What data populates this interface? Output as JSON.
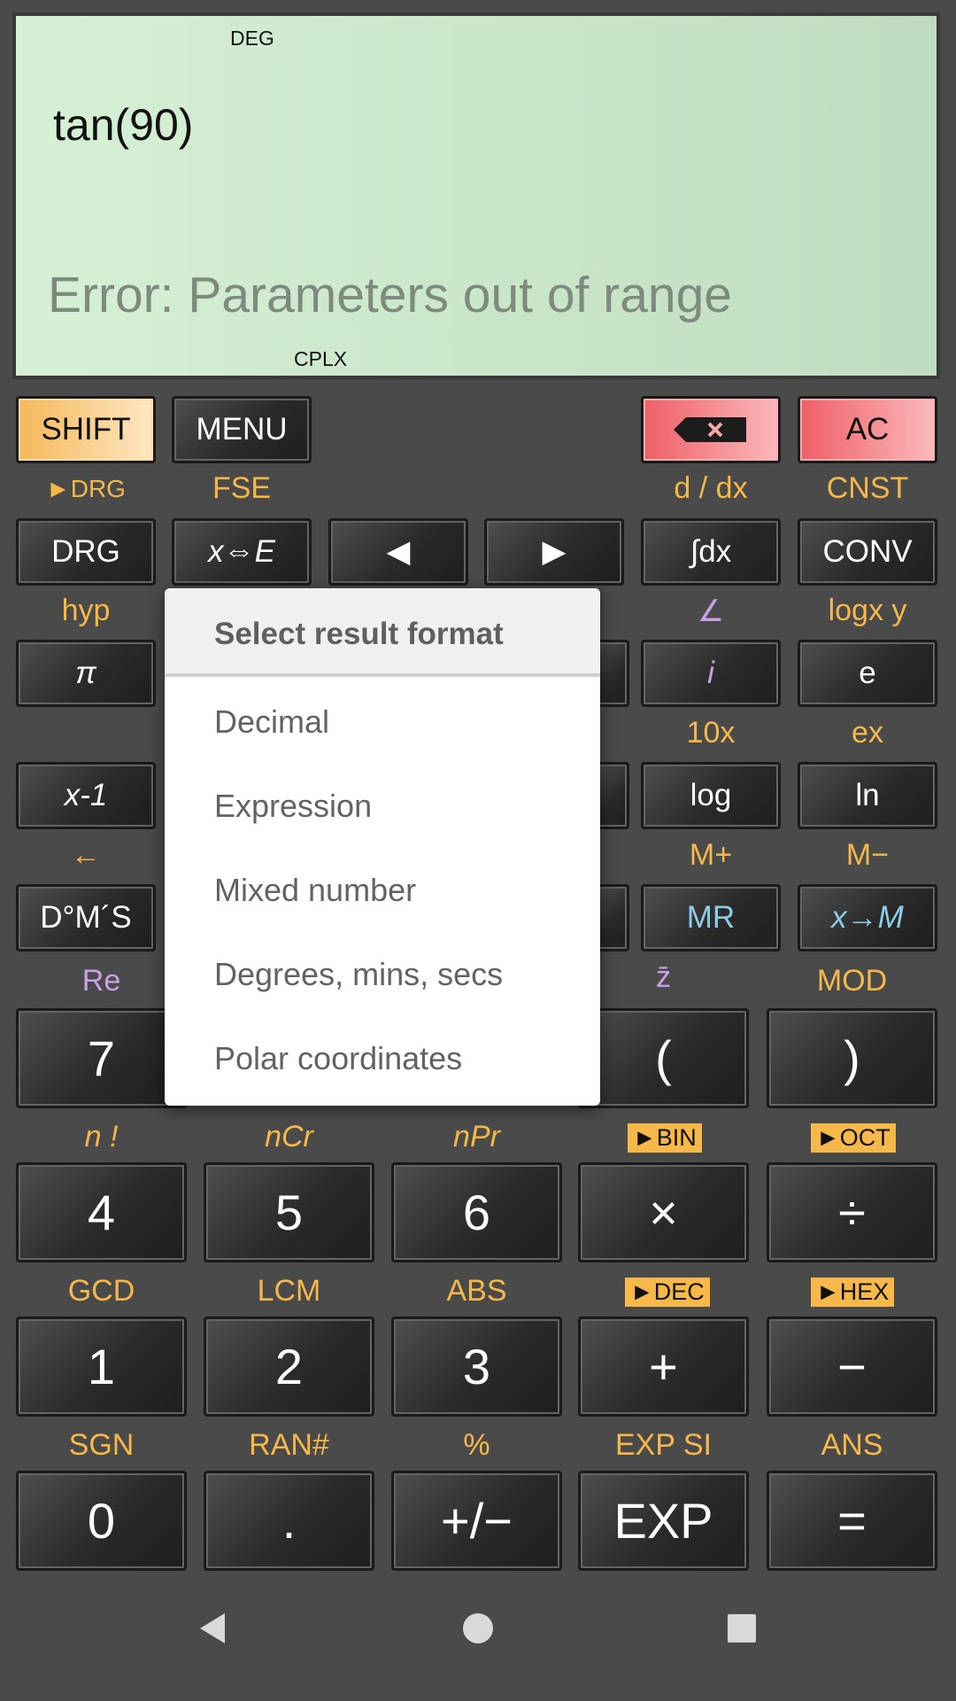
{
  "display": {
    "angle_mode": "DEG",
    "expression": "tan(90)",
    "result": "Error: Parameters out of range",
    "complex_mode": "CPLX"
  },
  "top_row": {
    "shift": "SHIFT",
    "menu": "MENU",
    "ac": "AC"
  },
  "row1": {
    "labels": [
      "►DRG",
      "FSE",
      "d / dx",
      "CNST"
    ],
    "drg": "DRG",
    "fse": "x⇔E",
    "left": "◀",
    "right": "▶",
    "integral": "∫dx",
    "conv": "CONV"
  },
  "row2": {
    "labels": [
      "hyp",
      "∠",
      "logx y"
    ],
    "pi": "π",
    "i": "i",
    "e": "e"
  },
  "row3": {
    "labels": [
      "10x",
      "ex"
    ],
    "inverse": "x-1",
    "log": "log",
    "ln": "ln"
  },
  "row4": {
    "labels": [
      "←",
      "M+",
      "M−"
    ],
    "dms": "D°M´S",
    "mr": "MR",
    "xm": "x→M"
  },
  "row5": {
    "labels": [
      "Re",
      "z̄",
      "MOD"
    ],
    "seven": "7",
    "open_paren": "(",
    "close_paren": ")"
  },
  "row6": {
    "labels": [
      "n !",
      "nCr",
      "nPr",
      "►BIN",
      "►OCT"
    ],
    "keys": [
      "4",
      "5",
      "6",
      "×",
      "÷"
    ]
  },
  "row7": {
    "labels": [
      "GCD",
      "LCM",
      "ABS",
      "►DEC",
      "►HEX"
    ],
    "keys": [
      "1",
      "2",
      "3",
      "+",
      "−"
    ]
  },
  "row8": {
    "labels": [
      "SGN",
      "RAN#",
      "%",
      "EXP SI",
      "ANS"
    ],
    "keys": [
      "0",
      ".",
      "+/−",
      "EXP",
      "="
    ]
  },
  "popup": {
    "title": "Select result format",
    "options": [
      "Decimal",
      "Expression",
      "Mixed number",
      "Degrees, mins, secs",
      "Polar coordinates"
    ]
  },
  "colors": {
    "shift_accent": "#f5b849",
    "hyp_accent": "#c9a2e6",
    "memory_accent": "#8fcde6",
    "clear_red": "#ee5f66"
  }
}
